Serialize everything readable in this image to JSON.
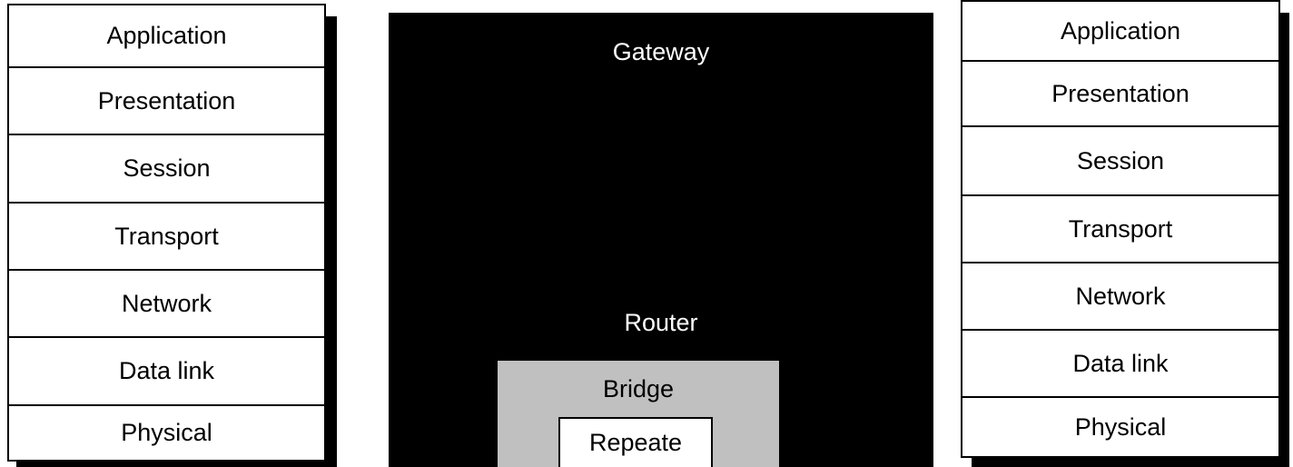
{
  "left_stack": {
    "layers": [
      "Application",
      "Presentation",
      "Session",
      "Transport",
      "Network",
      "Data link",
      "Physical"
    ]
  },
  "devices": {
    "gateway": "Gateway",
    "router": "Router",
    "bridge": "Bridge",
    "repeater": "Repeate"
  },
  "right_stack": {
    "layers": [
      "Application",
      "Presentation",
      "Session",
      "Transport",
      "Network",
      "Data link",
      "Physical"
    ]
  },
  "colors": {
    "gateway_fill": "#000000",
    "bridge_fill": "#c0c0c0",
    "repeater_fill": "#ffffff",
    "stack_fill": "#ffffff"
  }
}
